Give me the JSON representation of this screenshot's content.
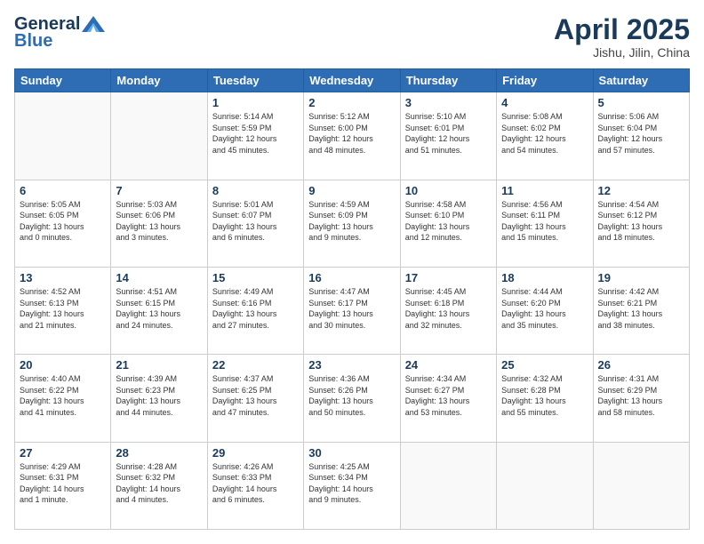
{
  "header": {
    "logo_text_general": "General",
    "logo_text_blue": "Blue",
    "month_year": "April 2025",
    "location": "Jishu, Jilin, China"
  },
  "days_of_week": [
    "Sunday",
    "Monday",
    "Tuesday",
    "Wednesday",
    "Thursday",
    "Friday",
    "Saturday"
  ],
  "weeks": [
    [
      {
        "day": "",
        "info": ""
      },
      {
        "day": "",
        "info": ""
      },
      {
        "day": "1",
        "info": "Sunrise: 5:14 AM\nSunset: 5:59 PM\nDaylight: 12 hours\nand 45 minutes."
      },
      {
        "day": "2",
        "info": "Sunrise: 5:12 AM\nSunset: 6:00 PM\nDaylight: 12 hours\nand 48 minutes."
      },
      {
        "day": "3",
        "info": "Sunrise: 5:10 AM\nSunset: 6:01 PM\nDaylight: 12 hours\nand 51 minutes."
      },
      {
        "day": "4",
        "info": "Sunrise: 5:08 AM\nSunset: 6:02 PM\nDaylight: 12 hours\nand 54 minutes."
      },
      {
        "day": "5",
        "info": "Sunrise: 5:06 AM\nSunset: 6:04 PM\nDaylight: 12 hours\nand 57 minutes."
      }
    ],
    [
      {
        "day": "6",
        "info": "Sunrise: 5:05 AM\nSunset: 6:05 PM\nDaylight: 13 hours\nand 0 minutes."
      },
      {
        "day": "7",
        "info": "Sunrise: 5:03 AM\nSunset: 6:06 PM\nDaylight: 13 hours\nand 3 minutes."
      },
      {
        "day": "8",
        "info": "Sunrise: 5:01 AM\nSunset: 6:07 PM\nDaylight: 13 hours\nand 6 minutes."
      },
      {
        "day": "9",
        "info": "Sunrise: 4:59 AM\nSunset: 6:09 PM\nDaylight: 13 hours\nand 9 minutes."
      },
      {
        "day": "10",
        "info": "Sunrise: 4:58 AM\nSunset: 6:10 PM\nDaylight: 13 hours\nand 12 minutes."
      },
      {
        "day": "11",
        "info": "Sunrise: 4:56 AM\nSunset: 6:11 PM\nDaylight: 13 hours\nand 15 minutes."
      },
      {
        "day": "12",
        "info": "Sunrise: 4:54 AM\nSunset: 6:12 PM\nDaylight: 13 hours\nand 18 minutes."
      }
    ],
    [
      {
        "day": "13",
        "info": "Sunrise: 4:52 AM\nSunset: 6:13 PM\nDaylight: 13 hours\nand 21 minutes."
      },
      {
        "day": "14",
        "info": "Sunrise: 4:51 AM\nSunset: 6:15 PM\nDaylight: 13 hours\nand 24 minutes."
      },
      {
        "day": "15",
        "info": "Sunrise: 4:49 AM\nSunset: 6:16 PM\nDaylight: 13 hours\nand 27 minutes."
      },
      {
        "day": "16",
        "info": "Sunrise: 4:47 AM\nSunset: 6:17 PM\nDaylight: 13 hours\nand 30 minutes."
      },
      {
        "day": "17",
        "info": "Sunrise: 4:45 AM\nSunset: 6:18 PM\nDaylight: 13 hours\nand 32 minutes."
      },
      {
        "day": "18",
        "info": "Sunrise: 4:44 AM\nSunset: 6:20 PM\nDaylight: 13 hours\nand 35 minutes."
      },
      {
        "day": "19",
        "info": "Sunrise: 4:42 AM\nSunset: 6:21 PM\nDaylight: 13 hours\nand 38 minutes."
      }
    ],
    [
      {
        "day": "20",
        "info": "Sunrise: 4:40 AM\nSunset: 6:22 PM\nDaylight: 13 hours\nand 41 minutes."
      },
      {
        "day": "21",
        "info": "Sunrise: 4:39 AM\nSunset: 6:23 PM\nDaylight: 13 hours\nand 44 minutes."
      },
      {
        "day": "22",
        "info": "Sunrise: 4:37 AM\nSunset: 6:25 PM\nDaylight: 13 hours\nand 47 minutes."
      },
      {
        "day": "23",
        "info": "Sunrise: 4:36 AM\nSunset: 6:26 PM\nDaylight: 13 hours\nand 50 minutes."
      },
      {
        "day": "24",
        "info": "Sunrise: 4:34 AM\nSunset: 6:27 PM\nDaylight: 13 hours\nand 53 minutes."
      },
      {
        "day": "25",
        "info": "Sunrise: 4:32 AM\nSunset: 6:28 PM\nDaylight: 13 hours\nand 55 minutes."
      },
      {
        "day": "26",
        "info": "Sunrise: 4:31 AM\nSunset: 6:29 PM\nDaylight: 13 hours\nand 58 minutes."
      }
    ],
    [
      {
        "day": "27",
        "info": "Sunrise: 4:29 AM\nSunset: 6:31 PM\nDaylight: 14 hours\nand 1 minute."
      },
      {
        "day": "28",
        "info": "Sunrise: 4:28 AM\nSunset: 6:32 PM\nDaylight: 14 hours\nand 4 minutes."
      },
      {
        "day": "29",
        "info": "Sunrise: 4:26 AM\nSunset: 6:33 PM\nDaylight: 14 hours\nand 6 minutes."
      },
      {
        "day": "30",
        "info": "Sunrise: 4:25 AM\nSunset: 6:34 PM\nDaylight: 14 hours\nand 9 minutes."
      },
      {
        "day": "",
        "info": ""
      },
      {
        "day": "",
        "info": ""
      },
      {
        "day": "",
        "info": ""
      }
    ]
  ]
}
